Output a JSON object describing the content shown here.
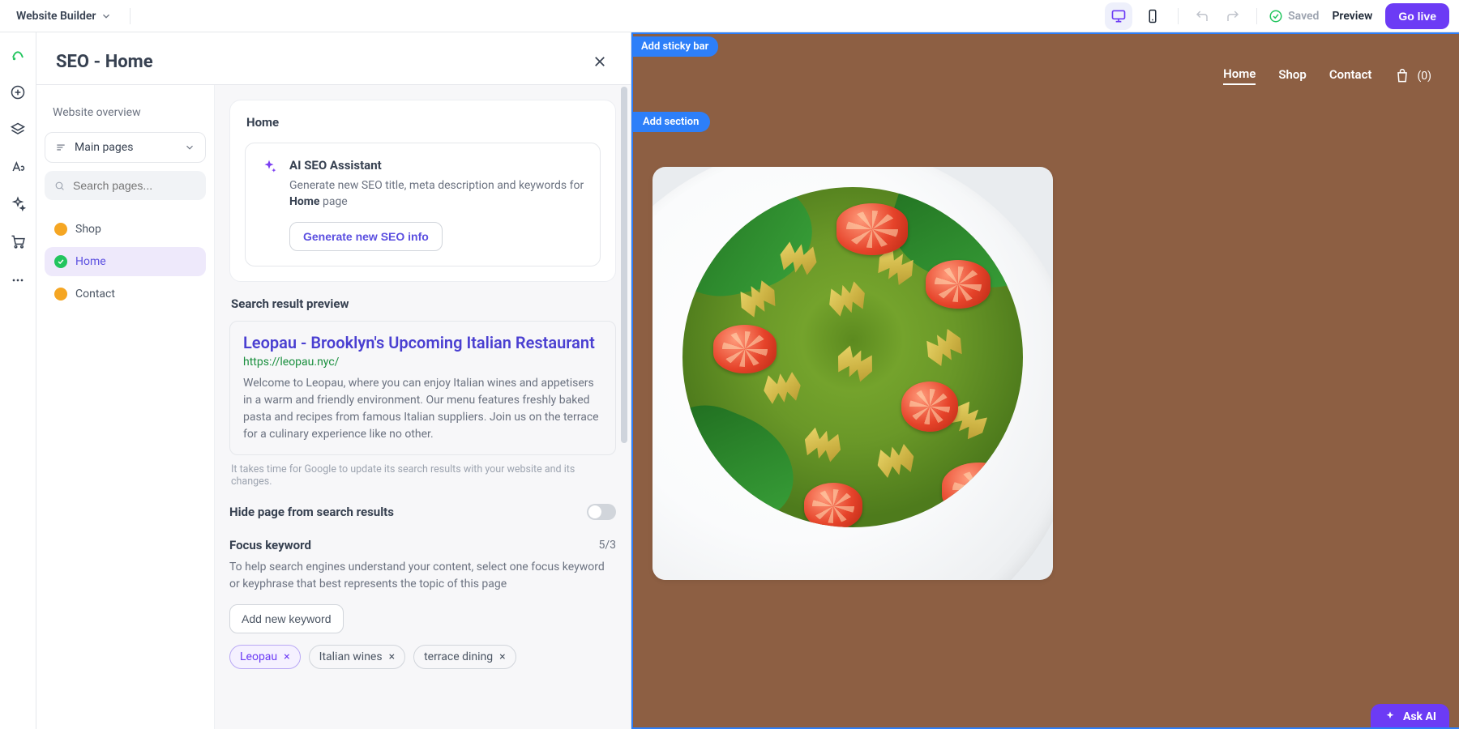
{
  "topbar": {
    "brand": "Website Builder",
    "saved_label": "Saved",
    "preview_label": "Preview",
    "golive_label": "Go live"
  },
  "panel": {
    "title": "SEO - Home",
    "sidebar": {
      "overview_label": "Website overview",
      "dropdown_label": "Main pages",
      "search_placeholder": "Search pages...",
      "items": [
        {
          "label": "Shop",
          "status": "orange"
        },
        {
          "label": "Home",
          "status": "green",
          "active": true
        },
        {
          "label": "Contact",
          "status": "orange"
        }
      ]
    },
    "content": {
      "page_name": "Home",
      "ai_title": "AI SEO Assistant",
      "ai_desc_pre": "Generate new SEO title, meta description and keywords for ",
      "ai_desc_bold": "Home",
      "ai_desc_post": " page",
      "generate_btn": "Generate new SEO info",
      "serp_section_label": "Search result preview",
      "serp": {
        "title": "Leopau - Brooklyn's Upcoming Italian Restaurant",
        "url": "https://leopau.nyc/",
        "desc": "Welcome to Leopau, where you can enjoy Italian wines and appetisers in a warm and friendly environment. Our menu features freshly baked pasta and recipes from famous Italian suppliers. Join us on the terrace for a culinary experience like no other."
      },
      "serp_hint": "It takes time for Google to update its search results with your website and its changes.",
      "hide_label": "Hide page from search results",
      "kw_label": "Focus keyword",
      "kw_count": "5/3",
      "kw_desc": "To help search engines understand your content, select one focus keyword or keyphrase that best represents the topic of this page",
      "add_kw_btn": "Add new keyword",
      "keywords": [
        {
          "text": "Leopau",
          "primary": true
        },
        {
          "text": "Italian wines"
        },
        {
          "text": "terrace dining"
        }
      ]
    }
  },
  "canvas": {
    "sticky_label": "Add sticky bar",
    "section_label": "Add section",
    "nav": {
      "home": "Home",
      "shop": "Shop",
      "contact": "Contact",
      "cart_count": "(0)"
    },
    "askai_label": "Ask AI"
  }
}
